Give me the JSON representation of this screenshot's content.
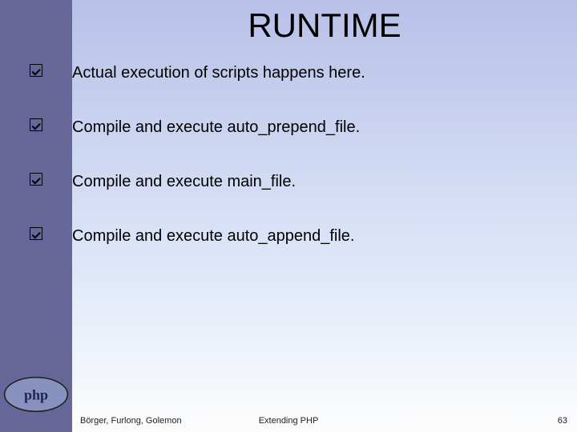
{
  "title": "RUNTIME",
  "bullets": [
    "Actual execution of scripts happens here.",
    "Compile and execute auto_prepend_file.",
    "Compile and execute main_file.",
    "Compile and execute auto_append_file."
  ],
  "footer": {
    "authors": "Börger, Furlong, Golemon",
    "center": "Extending PHP",
    "page": "63"
  },
  "logo_text": "php"
}
